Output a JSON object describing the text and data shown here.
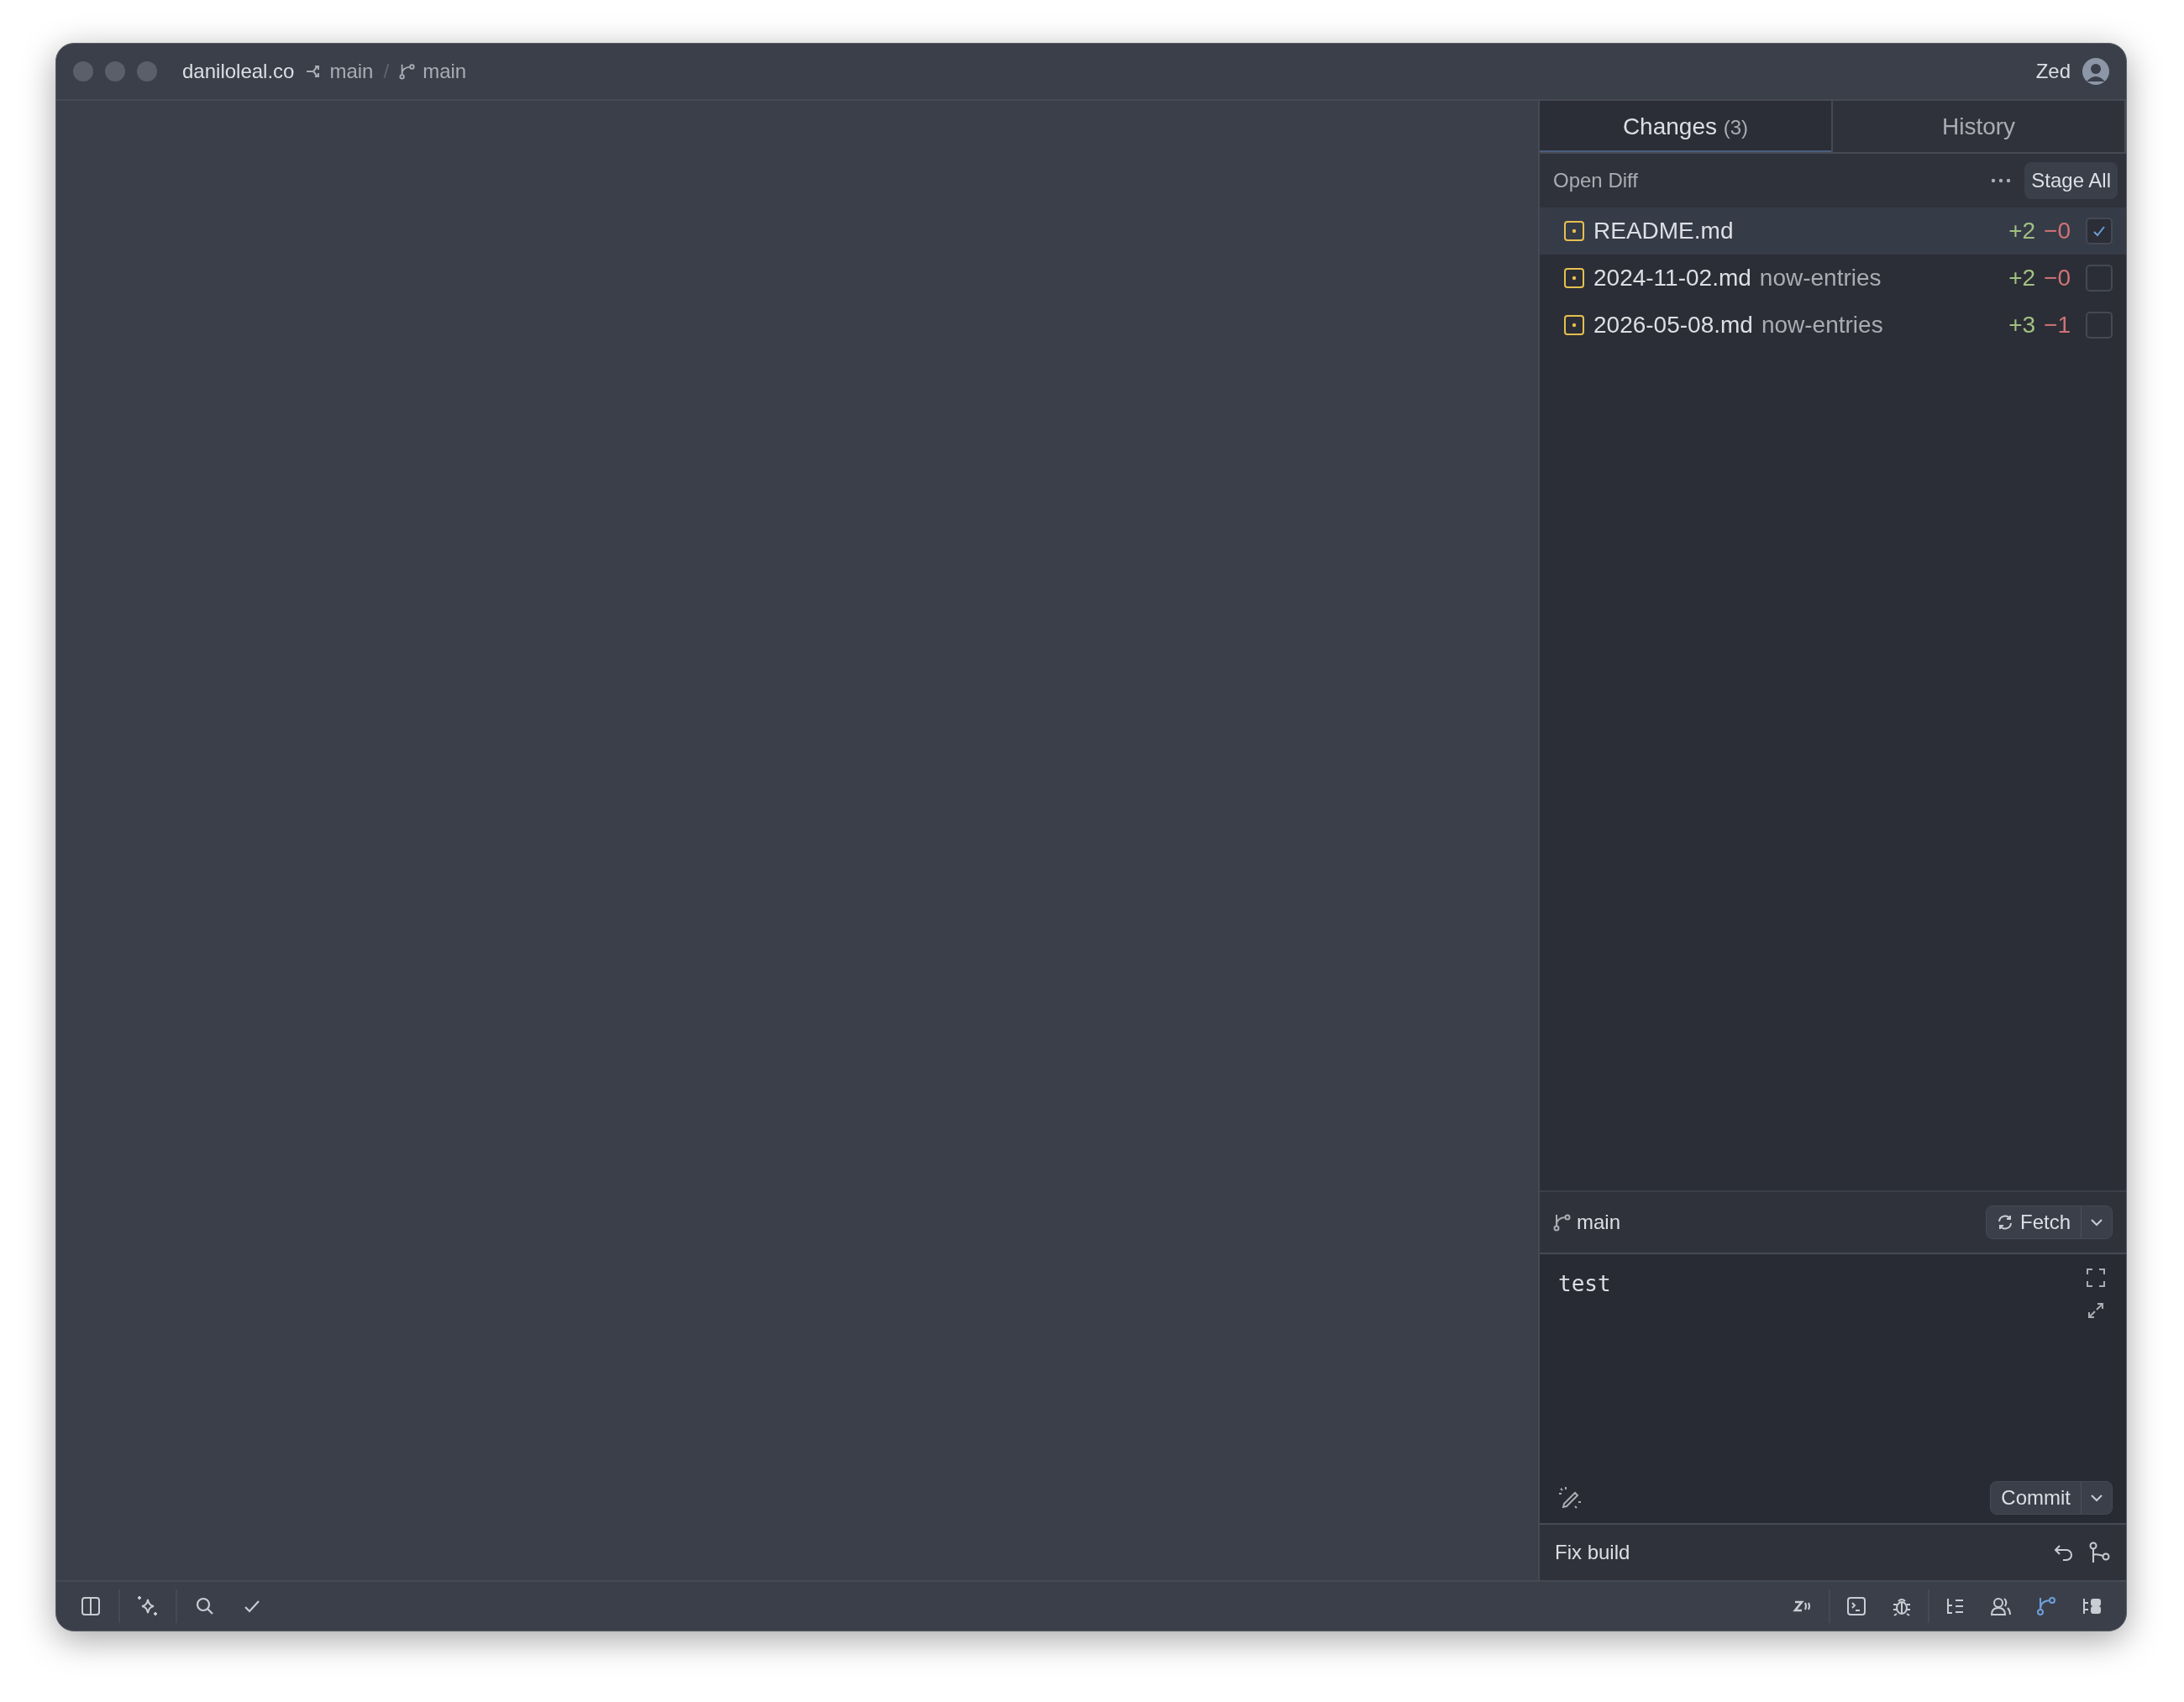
{
  "window": {
    "title": "daniloleal.co"
  },
  "breadcrumbs": [
    {
      "kind": "worktree",
      "label": "main"
    },
    {
      "kind": "separator",
      "label": "/"
    },
    {
      "kind": "branch",
      "label": "main"
    }
  ],
  "user": {
    "name": "Zed"
  },
  "panel": {
    "tabs": [
      {
        "label": "Changes",
        "count": "(3)",
        "selected": true
      },
      {
        "label": "History",
        "selected": false
      }
    ],
    "open_diff": "Open Diff",
    "stage_all": "Stage All",
    "files": [
      {
        "name": "README.md",
        "added": "+2",
        "removed": "−0",
        "checked": true,
        "selected": true
      },
      {
        "name": "2024-11-02.md",
        "folder": "now-entries",
        "added": "+2",
        "removed": "−0",
        "checked": false,
        "selected": false
      },
      {
        "name": "2026-05-08.md",
        "folder": "now-entries",
        "added": "+3",
        "removed": "−1",
        "checked": false,
        "selected": false
      }
    ],
    "branch": "main",
    "fetch": "Fetch",
    "commit_message": "test",
    "commit": "Commit",
    "last_commit": "Fix build"
  },
  "status_bar": {
    "right": [
      {
        "kind": "zeta",
        "selected": false
      },
      {
        "kind": "terminal",
        "selected": false
      },
      {
        "kind": "debug",
        "selected": false
      },
      {
        "kind": "outline",
        "selected": false
      },
      {
        "kind": "collab",
        "selected": false
      },
      {
        "kind": "git",
        "selected": true
      },
      {
        "kind": "notes",
        "selected": false
      }
    ]
  }
}
